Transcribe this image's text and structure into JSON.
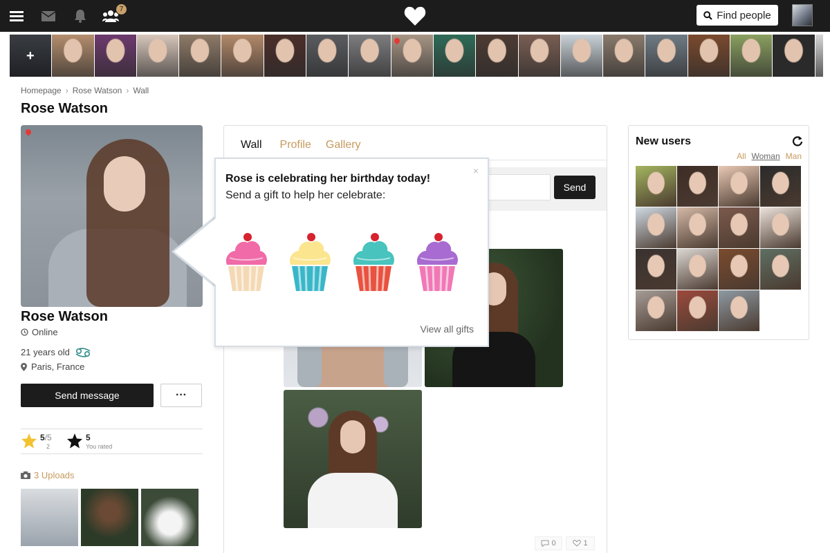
{
  "topbar": {
    "icons": [
      "menu-icon",
      "mail-icon",
      "bell-icon",
      "users-icon"
    ],
    "friend_badge": "7",
    "logo": "heart-logo",
    "find_people": "Find people"
  },
  "strip": {
    "colors": [
      "#3a3d42",
      "#b58e6e",
      "#6d3a6e",
      "#d8c7bb",
      "#8f7b68",
      "#b3896a",
      "#4b2e2a",
      "#5a5c60",
      "#7d7d80",
      "#a89685",
      "#2f6b58",
      "#4d3b33",
      "#7a5e53",
      "#c9d2d8",
      "#8a7a6c",
      "#6f7b84",
      "#7b4a2e",
      "#8aa060",
      "#2a2a2a",
      "#d6d6d6"
    ],
    "pins": [
      9
    ]
  },
  "breadcrumb": {
    "items": [
      "Homepage",
      "Rose Watson",
      "Wall"
    ],
    "sep": "›"
  },
  "page_title": "Rose Watson",
  "profile": {
    "name": "Rose Watson",
    "status": "Online",
    "age": "21 years old",
    "zodiac": "cancer-icon",
    "location": "Paris, France",
    "send_message": "Send message",
    "more": "···",
    "rating": {
      "score": "5",
      "of": "/5",
      "votes": "2",
      "your_score": "5",
      "your_label": "You rated"
    },
    "uploads": "3 Uploads"
  },
  "wall": {
    "tabs": [
      "Wall",
      "Profile",
      "Gallery"
    ],
    "send": "Send",
    "comments": "0",
    "likes": "1"
  },
  "popup": {
    "close": "×",
    "title": "Rose is celebrating her birthday today!",
    "subtitle": "Send a gift to help her celebrate:",
    "gifts": [
      {
        "name": "pink-cupcake-gift",
        "frosting": "#f06ba8",
        "liner": "#f4d9b5"
      },
      {
        "name": "yellow-cupcake-gift",
        "frosting": "#fbe58e",
        "liner": "#39b7c9"
      },
      {
        "name": "teal-cupcake-gift",
        "frosting": "#48c3bd",
        "liner": "#e8523f"
      },
      {
        "name": "purple-cupcake-gift",
        "frosting": "#a86bd1",
        "liner": "#f178b6"
      }
    ],
    "view_all": "View all gifts"
  },
  "new_users": {
    "title": "New users",
    "filters": [
      "All",
      "Woman",
      "Man"
    ],
    "active_filter": "Woman",
    "colors": [
      "#a4b55f",
      "#3e2d26",
      "#e9c8b4",
      "#2b2b2b",
      "#cfd9e2",
      "#d4b8a6",
      "#7c5a4c",
      "#ece3dc",
      "#3a3230",
      "#dcd6d2",
      "#7a4b2e",
      "#5f6f63",
      "#a69d97",
      "#9c4a3c",
      "#8e9aa3"
    ]
  },
  "colors": {
    "accent": "#c59a5c",
    "dark": "#1c1c1c"
  }
}
